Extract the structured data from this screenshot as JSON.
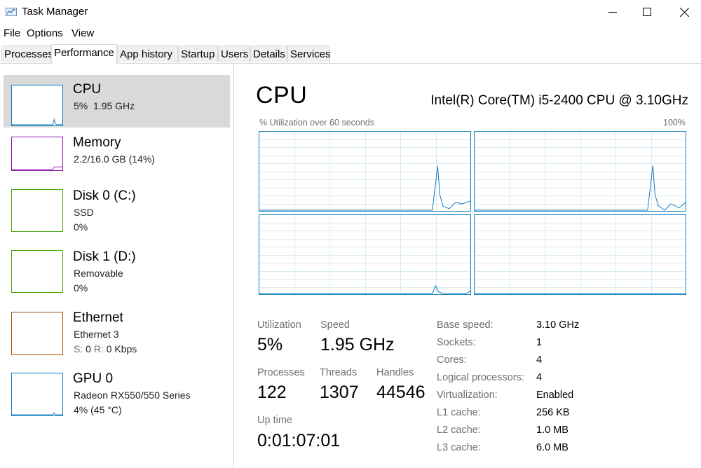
{
  "window": {
    "title": "Task Manager",
    "icon": "task-manager-icon"
  },
  "menu": [
    "File",
    "Options",
    "View"
  ],
  "tabs": [
    "Processes",
    "Performance",
    "App history",
    "Startup",
    "Users",
    "Details",
    "Services"
  ],
  "active_tab": "Performance",
  "sidebar": {
    "items": [
      {
        "title": "CPU",
        "line1": "5%  1.95 GHz",
        "line2": "",
        "color": "#117dbb",
        "active": true
      },
      {
        "title": "Memory",
        "line1": "2.2/16.0 GB (14%)",
        "line2": "",
        "color": "#8b12ae"
      },
      {
        "title": "Disk 0 (C:)",
        "line1": "SSD",
        "line2": "0%",
        "color": "#4da60c"
      },
      {
        "title": "Disk 1 (D:)",
        "line1": "Removable",
        "line2": "0%",
        "color": "#4da60c"
      },
      {
        "title": "Ethernet",
        "line1": "Ethernet 3",
        "line2_s": "S:",
        "line2_s_val": "0",
        "line2_r": "R:",
        "line2_r_val": "0 Kbps",
        "color": "#a74f01"
      },
      {
        "title": "GPU 0",
        "line1": "Radeon RX550/550 Series",
        "line2": "4% (45 °C)",
        "color": "#117dbb"
      }
    ]
  },
  "main": {
    "title": "CPU",
    "cpu_name": "Intel(R) Core(TM) i5-2400 CPU @ 3.10GHz",
    "graph_caption": "% Utilization over 60 seconds",
    "graph_max": "100%",
    "stats": {
      "utilization_label": "Utilization",
      "utilization": "5%",
      "speed_label": "Speed",
      "speed": "1.95 GHz",
      "processes_label": "Processes",
      "processes": "122",
      "threads_label": "Threads",
      "threads": "1307",
      "handles_label": "Handles",
      "handles": "44546",
      "uptime_label": "Up time",
      "uptime": "0:01:07:01"
    },
    "specs": [
      {
        "label": "Base speed:",
        "value": "3.10 GHz"
      },
      {
        "label": "Sockets:",
        "value": "1"
      },
      {
        "label": "Cores:",
        "value": "4"
      },
      {
        "label": "Logical processors:",
        "value": "4"
      },
      {
        "label": "Virtualization:",
        "value": "Enabled"
      },
      {
        "label": "L1 cache:",
        "value": "256 KB"
      },
      {
        "label": "L2 cache:",
        "value": "1.0 MB"
      },
      {
        "label": "L3 cache:",
        "value": "6.0 MB"
      }
    ]
  },
  "colors": {
    "cpu": "#117dbb",
    "grid": "#d9eaf4",
    "border": "#117dbb"
  }
}
